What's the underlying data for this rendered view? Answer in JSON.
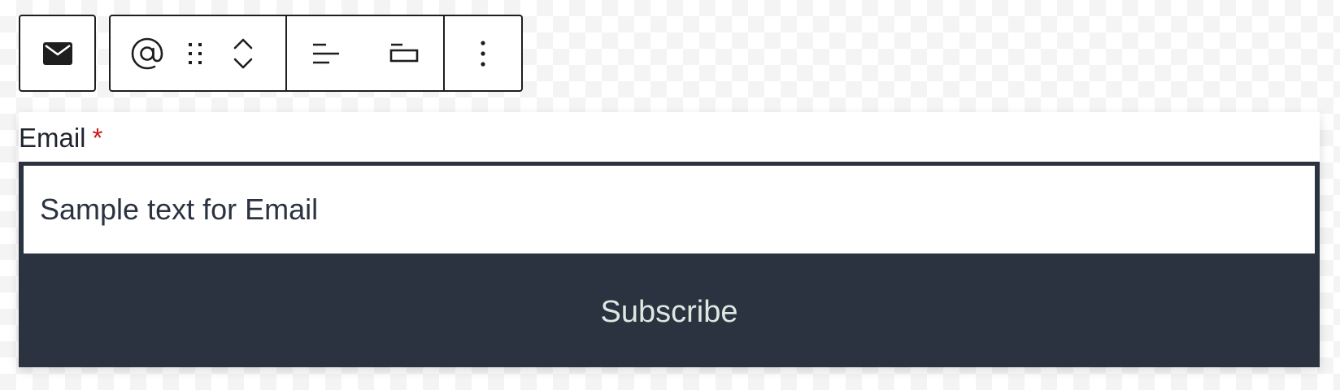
{
  "toolbar": {
    "groups": [
      {
        "icons": [
          "envelope-icon"
        ]
      },
      {
        "icons": [
          "at-sign-icon",
          "drag-handle-icon",
          "move-up-icon",
          "move-down-icon",
          "justify-left-icon",
          "width-icon",
          "more-options-icon"
        ]
      }
    ]
  },
  "form": {
    "label": "Email",
    "required_marker": "*",
    "input_placeholder": "Sample text for Email",
    "submit_label": "Subscribe"
  },
  "colors": {
    "button_bg": "#2b3340",
    "button_text": "#dde8e2",
    "required": "#cc1818",
    "toolbar_border": "#1e1e1e"
  }
}
